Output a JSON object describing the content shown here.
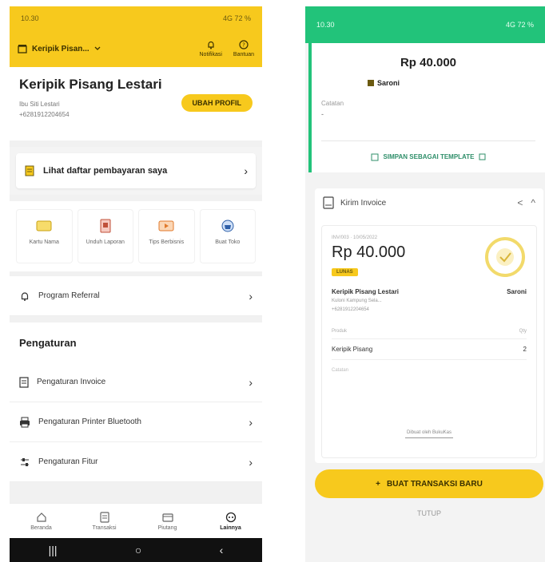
{
  "left": {
    "status_bar": {
      "time": "10.30",
      "right": "4G 72 %"
    },
    "app_bar": {
      "store_name": "Keripik Pisan...",
      "notif_label": "Notifikasi",
      "help_label": "Bantuan"
    },
    "profile": {
      "business_name": "Keripik Pisang Lestari",
      "owner": "Ibu Siti Lestari",
      "phone": "+6281912204654",
      "edit_button": "UBAH PROFIL"
    },
    "payment_list_link": "Lihat daftar pembayaran saya",
    "tiles": [
      {
        "label": "Kartu Nama",
        "icon": "card-icon"
      },
      {
        "label": "Unduh Laporan",
        "icon": "report-icon"
      },
      {
        "label": "Tips Berbisnis",
        "icon": "tips-icon"
      },
      {
        "label": "Buat Toko",
        "icon": "store-icon"
      }
    ],
    "referral": "Program Referral",
    "settings_heading": "Pengaturan",
    "settings": [
      {
        "label": "Pengaturan Invoice",
        "icon": "invoice-icon"
      },
      {
        "label": "Pengaturan Printer Bluetooth",
        "icon": "printer-icon"
      },
      {
        "label": "Pengaturan Fitur",
        "icon": "sliders-icon"
      }
    ],
    "bottom_nav": [
      {
        "label": "Beranda",
        "icon": "home-icon",
        "active": false
      },
      {
        "label": "Transaksi",
        "icon": "transaction-icon",
        "active": false
      },
      {
        "label": "Piutang",
        "icon": "receivable-icon",
        "active": false
      },
      {
        "label": "Lainnya",
        "icon": "more-icon",
        "active": true
      }
    ]
  },
  "right": {
    "status_bar": {
      "time": "10.30",
      "right": "4G 72 %"
    },
    "amount": "Rp 40.000",
    "recipient": "Saroni",
    "notes_label": "Catatan",
    "notes_value": "-",
    "save_template": "SIMPAN SEBAGAI TEMPLATE",
    "invoice_title": "Kirim Invoice",
    "receipt": {
      "meta": "INV/003 · 10/05/2022",
      "amount": "Rp 40.000",
      "badge": "LUNAS",
      "seller": "Keripik Pisang Lestari",
      "buyer": "Saroni",
      "address": "Kuloni Kampung Sela...",
      "seller_phone": "+6281912204654",
      "item_head_left": "Produk",
      "item_head_right": "Qty",
      "item_name": "Keripik Pisang",
      "item_qty": "2",
      "note": "Catatan",
      "footer": "Dibuat oleh BukuKas"
    },
    "cta": "BUAT TRANSAKSI BARU",
    "close": "TUTUP"
  },
  "colors": {
    "yellow": "#f7c91d",
    "green": "#22c37a"
  }
}
